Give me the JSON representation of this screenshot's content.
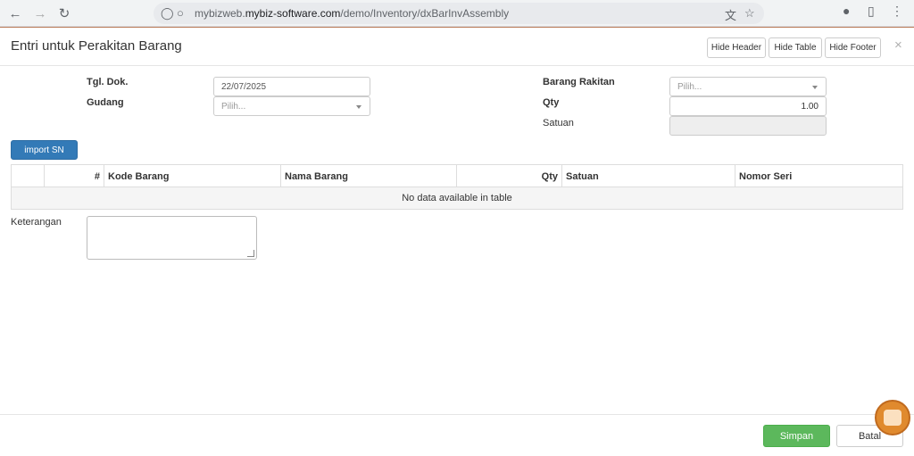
{
  "browser": {
    "url_prefix": "mybizweb.",
    "url_domain": "mybiz-software.com",
    "url_path": "/demo/Inventory/dxBarInvAssembly"
  },
  "modal": {
    "title": "Entri untuk Perakitan Barang",
    "hide_header": "Hide Header",
    "hide_table": "Hide Table",
    "hide_footer": "Hide Footer",
    "close": "×"
  },
  "form": {
    "tgl_dok_label": "Tgl. Dok.",
    "tgl_dok_value": "22/07/2025",
    "gudang_label": "Gudang",
    "gudang_placeholder": "Pilih...",
    "barang_rakitan_label": "Barang Rakitan",
    "barang_rakitan_placeholder": "Pilih...",
    "qty_label": "Qty",
    "qty_value": "1.00",
    "satuan_label": "Satuan",
    "satuan_value": ""
  },
  "import_sn": "import SN",
  "table": {
    "columns": [
      "",
      "#",
      "Kode Barang",
      "Nama Barang",
      "Qty",
      "Satuan",
      "Nomor Seri"
    ],
    "empty_text": "No data available in table"
  },
  "keterangan_label": "Keterangan",
  "footer": {
    "simpan": "Simpan",
    "batal": "Batal"
  }
}
